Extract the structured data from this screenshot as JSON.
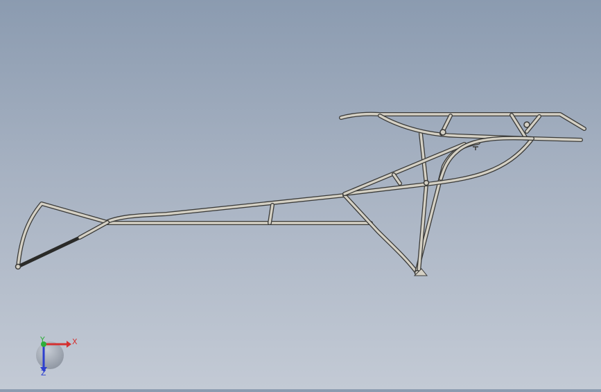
{
  "graphics_area": {
    "background_top": "#8b9bb0",
    "background_bottom": "#c3cad5",
    "model": {
      "name": "tube-frame-assembly",
      "tube_color": "#d4d0c4",
      "tube_edge_color": "#3a3a38"
    },
    "triad": {
      "x_label": "X",
      "y_label": "Y",
      "z_label": "Z",
      "x_color": "#d43030",
      "y_color": "#2fae3a",
      "z_color": "#2d3fcf"
    }
  }
}
